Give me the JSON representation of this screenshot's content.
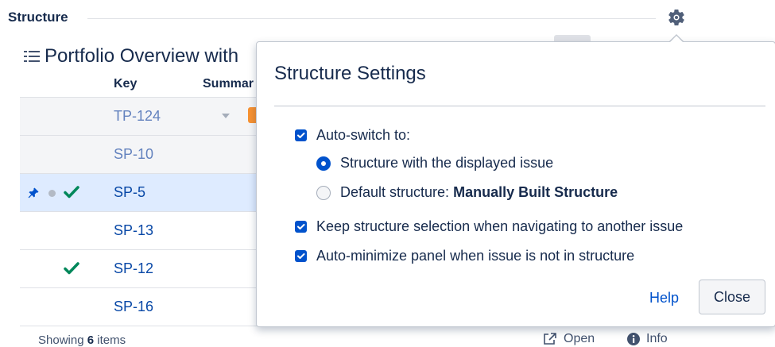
{
  "header": {
    "title": "Structure",
    "settings_icon": "gear-icon"
  },
  "structure": {
    "title": "Portfolio Overview with",
    "icon": "list-icon"
  },
  "table": {
    "columns": {
      "key": "Key",
      "summary": "Summar"
    },
    "rows": [
      {
        "key": "TP-124",
        "pinned": false,
        "dot": false,
        "check": false
      },
      {
        "key": "SP-10",
        "pinned": false,
        "dot": false,
        "check": false
      },
      {
        "key": "SP-5",
        "pinned": true,
        "dot": true,
        "check": true
      },
      {
        "key": "SP-13",
        "pinned": false,
        "dot": false,
        "check": false
      },
      {
        "key": "SP-12",
        "pinned": false,
        "dot": false,
        "check": true
      },
      {
        "key": "SP-16",
        "pinned": false,
        "dot": false,
        "check": false
      }
    ]
  },
  "footer": {
    "showing_prefix": "Showing",
    "showing_count": "6",
    "showing_suffix": "items",
    "open_label": "Open",
    "info_label": "Info"
  },
  "popup": {
    "title": "Structure Settings",
    "auto_switch": {
      "label": "Auto-switch to:",
      "checked": true
    },
    "radio_displayed": {
      "label": "Structure with the displayed issue",
      "selected": true
    },
    "radio_default": {
      "label_prefix": "Default structure:",
      "label_value": "Manually Built Structure",
      "selected": false
    },
    "keep_selection": {
      "label": "Keep structure selection when navigating to another issue",
      "checked": true
    },
    "auto_minimize": {
      "label": "Auto-minimize panel when issue is not in structure",
      "checked": true
    },
    "help_label": "Help",
    "close_label": "Close"
  },
  "colors": {
    "accent": "#0052cc",
    "check_green": "#00875a",
    "selected_row": "#deebff"
  }
}
